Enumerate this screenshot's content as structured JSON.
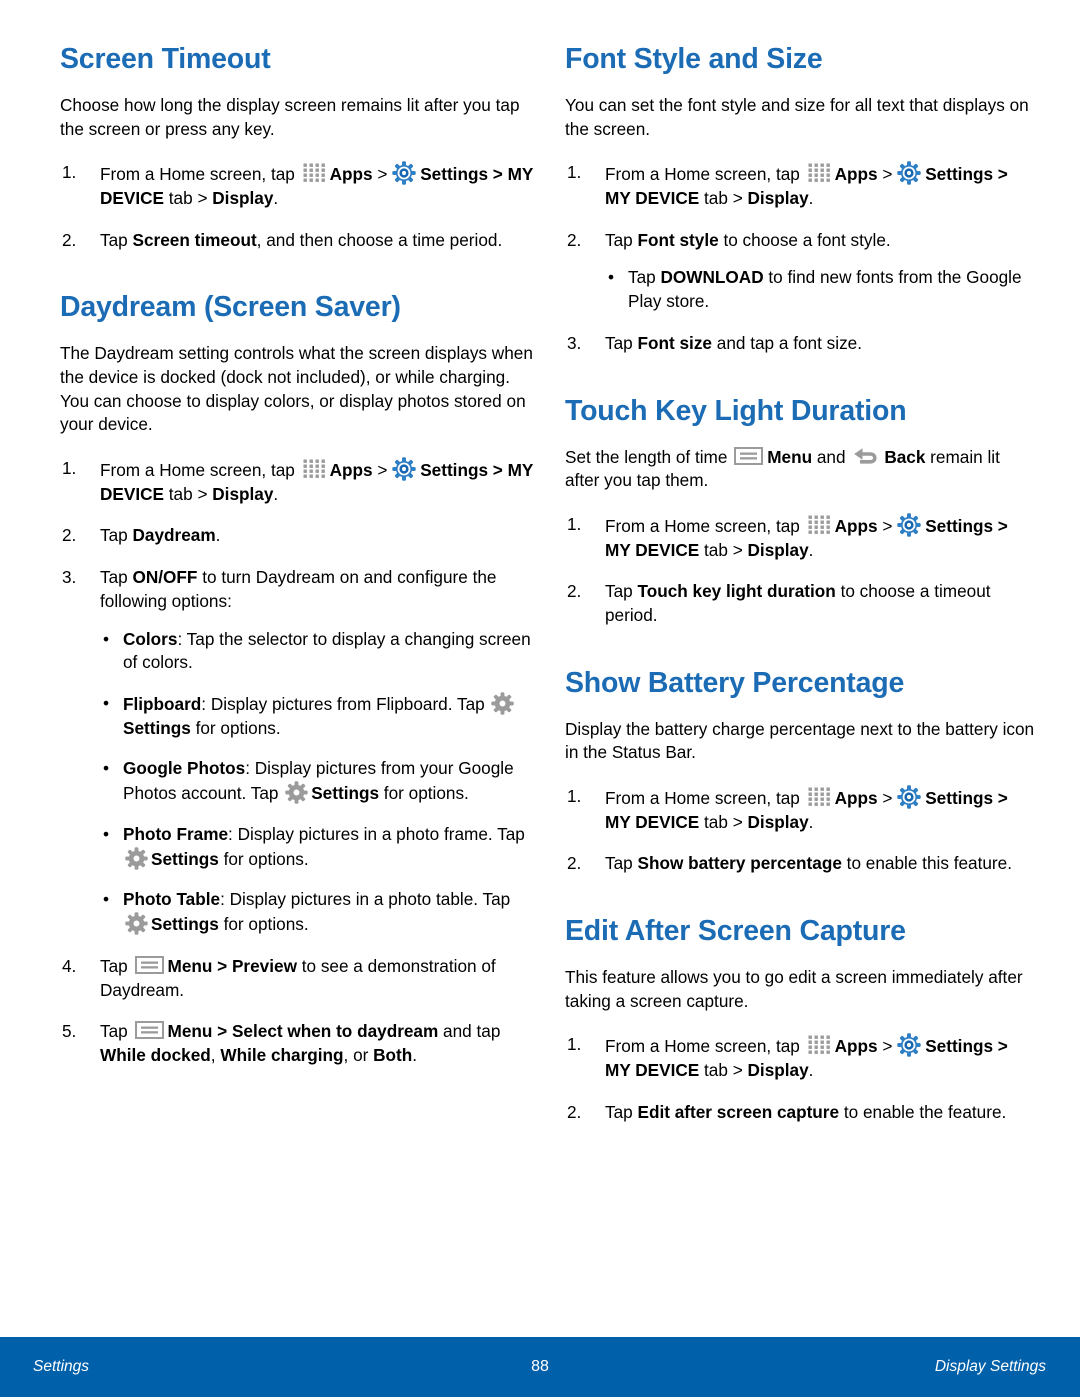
{
  "colors": {
    "heading_blue": "#1b6cb4",
    "footer_blue": "#0060a9",
    "settings_icon_blue": "#1b6cb4",
    "gray_icon": "#999999"
  },
  "left_column": {
    "sections": [
      {
        "heading": "Screen Timeout",
        "intro": "Choose how long the display screen remains lit after you tap the screen or press any key.",
        "steps": [
          {
            "num": "1.",
            "parts": [
              {
                "t": "text",
                "v": "From a Home screen, tap "
              },
              {
                "t": "icon",
                "v": "apps-grid-icon"
              },
              {
                "t": "bold",
                "v": "Apps"
              },
              {
                "t": "text",
                "v": " > "
              },
              {
                "t": "icon",
                "v": "settings-gear-blue-icon"
              },
              {
                "t": "bold",
                "v": "Settings > MY DEVICE"
              },
              {
                "t": "text",
                "v": " tab > "
              },
              {
                "t": "bold",
                "v": "Display"
              },
              {
                "t": "text",
                "v": "."
              }
            ]
          },
          {
            "num": "2.",
            "parts": [
              {
                "t": "text",
                "v": "Tap "
              },
              {
                "t": "bold",
                "v": "Screen timeout"
              },
              {
                "t": "text",
                "v": ", and then choose a time period."
              }
            ]
          }
        ]
      },
      {
        "heading": "Daydream (Screen Saver)",
        "intro": "The Daydream setting controls what the screen displays when the device is docked (dock not included), or while charging. You can choose to display colors, or display photos stored on your device.",
        "steps": [
          {
            "num": "1.",
            "parts": [
              {
                "t": "text",
                "v": "From a Home screen, tap "
              },
              {
                "t": "icon",
                "v": "apps-grid-icon"
              },
              {
                "t": "bold",
                "v": "Apps"
              },
              {
                "t": "text",
                "v": " > "
              },
              {
                "t": "icon",
                "v": "settings-gear-blue-icon"
              },
              {
                "t": "bold",
                "v": "Settings > MY DEVICE"
              },
              {
                "t": "text",
                "v": " tab > "
              },
              {
                "t": "bold",
                "v": "Display"
              },
              {
                "t": "text",
                "v": "."
              }
            ]
          },
          {
            "num": "2.",
            "parts": [
              {
                "t": "text",
                "v": "Tap "
              },
              {
                "t": "bold",
                "v": "Daydream"
              },
              {
                "t": "text",
                "v": "."
              }
            ]
          },
          {
            "num": "3.",
            "parts": [
              {
                "t": "text",
                "v": "Tap "
              },
              {
                "t": "bold",
                "v": "ON/OFF"
              },
              {
                "t": "text",
                "v": " to turn Daydream on and configure the following options:"
              }
            ],
            "bullets": [
              [
                {
                  "t": "bold",
                  "v": "Colors"
                },
                {
                  "t": "text",
                  "v": ": Tap the selector to display a changing screen of colors."
                }
              ],
              [
                {
                  "t": "bold",
                  "v": "Flipboard"
                },
                {
                  "t": "text",
                  "v": ": Display pictures from Flipboard. Tap "
                },
                {
                  "t": "icon",
                  "v": "settings-gear-gray-icon"
                },
                {
                  "t": "bold",
                  "v": "Settings"
                },
                {
                  "t": "text",
                  "v": " for options."
                }
              ],
              [
                {
                  "t": "bold",
                  "v": "Google Photos"
                },
                {
                  "t": "text",
                  "v": ": Display pictures from your Google Photos account. Tap "
                },
                {
                  "t": "icon",
                  "v": "settings-gear-gray-icon"
                },
                {
                  "t": "bold",
                  "v": "Settings"
                },
                {
                  "t": "text",
                  "v": " for options."
                }
              ],
              [
                {
                  "t": "bold",
                  "v": "Photo Frame"
                },
                {
                  "t": "text",
                  "v": ": Display pictures in a photo frame. Tap "
                },
                {
                  "t": "icon",
                  "v": "settings-gear-gray-icon"
                },
                {
                  "t": "bold",
                  "v": "Settings"
                },
                {
                  "t": "text",
                  "v": " for options."
                }
              ],
              [
                {
                  "t": "bold",
                  "v": "Photo Table"
                },
                {
                  "t": "text",
                  "v": ": Display pictures in a photo table. Tap "
                },
                {
                  "t": "icon",
                  "v": "settings-gear-gray-icon"
                },
                {
                  "t": "bold",
                  "v": "Settings"
                },
                {
                  "t": "text",
                  "v": " for options."
                }
              ]
            ]
          },
          {
            "num": "4.",
            "parts": [
              {
                "t": "text",
                "v": "Tap "
              },
              {
                "t": "icon",
                "v": "menu-icon"
              },
              {
                "t": "bold",
                "v": "Menu > Preview"
              },
              {
                "t": "text",
                "v": " to see a demonstration of Daydream."
              }
            ]
          },
          {
            "num": "5.",
            "parts": [
              {
                "t": "text",
                "v": "Tap "
              },
              {
                "t": "icon",
                "v": "menu-icon"
              },
              {
                "t": "bold",
                "v": "Menu > Select when to daydream"
              },
              {
                "t": "text",
                "v": " and tap "
              },
              {
                "t": "bold",
                "v": "While docked"
              },
              {
                "t": "text",
                "v": ", "
              },
              {
                "t": "bold",
                "v": "While charging"
              },
              {
                "t": "text",
                "v": ", or "
              },
              {
                "t": "bold",
                "v": "Both"
              },
              {
                "t": "text",
                "v": "."
              }
            ]
          }
        ]
      }
    ]
  },
  "right_column": {
    "sections": [
      {
        "heading": "Font Style and Size",
        "intro": "You can set the font style and size for all text that displays on the screen.",
        "steps": [
          {
            "num": "1.",
            "parts": [
              {
                "t": "text",
                "v": "From a Home screen, tap "
              },
              {
                "t": "icon",
                "v": "apps-grid-icon"
              },
              {
                "t": "bold",
                "v": "Apps"
              },
              {
                "t": "text",
                "v": " > "
              },
              {
                "t": "icon",
                "v": "settings-gear-blue-icon"
              },
              {
                "t": "bold",
                "v": "Settings > MY DEVICE"
              },
              {
                "t": "text",
                "v": " tab > "
              },
              {
                "t": "bold",
                "v": "Display"
              },
              {
                "t": "text",
                "v": "."
              }
            ]
          },
          {
            "num": "2.",
            "parts": [
              {
                "t": "text",
                "v": "Tap "
              },
              {
                "t": "bold",
                "v": "Font style"
              },
              {
                "t": "text",
                "v": " to choose a font style."
              }
            ],
            "bullets": [
              [
                {
                  "t": "text",
                  "v": "Tap "
                },
                {
                  "t": "bold",
                  "v": "DOWNLOAD"
                },
                {
                  "t": "text",
                  "v": " to find new fonts from the Google Play store."
                }
              ]
            ]
          },
          {
            "num": "3.",
            "parts": [
              {
                "t": "text",
                "v": "Tap "
              },
              {
                "t": "bold",
                "v": "Font size"
              },
              {
                "t": "text",
                "v": " and tap a font size."
              }
            ]
          }
        ]
      },
      {
        "heading": "Touch Key Light Duration",
        "intro_parts": [
          {
            "t": "text",
            "v": "Set the length of time "
          },
          {
            "t": "icon",
            "v": "menu-icon"
          },
          {
            "t": "bold",
            "v": "Menu"
          },
          {
            "t": "text",
            "v": " and "
          },
          {
            "t": "icon",
            "v": "back-arrow-icon"
          },
          {
            "t": "bold",
            "v": "Back"
          },
          {
            "t": "text",
            "v": " remain lit after you tap them."
          }
        ],
        "steps": [
          {
            "num": "1.",
            "parts": [
              {
                "t": "text",
                "v": "From a Home screen, tap "
              },
              {
                "t": "icon",
                "v": "apps-grid-icon"
              },
              {
                "t": "bold",
                "v": "Apps"
              },
              {
                "t": "text",
                "v": " > "
              },
              {
                "t": "icon",
                "v": "settings-gear-blue-icon"
              },
              {
                "t": "bold",
                "v": "Settings > MY DEVICE"
              },
              {
                "t": "text",
                "v": " tab > "
              },
              {
                "t": "bold",
                "v": "Display"
              },
              {
                "t": "text",
                "v": "."
              }
            ]
          },
          {
            "num": "2.",
            "parts": [
              {
                "t": "text",
                "v": "Tap "
              },
              {
                "t": "bold",
                "v": "Touch key light duration"
              },
              {
                "t": "text",
                "v": " to choose a timeout period."
              }
            ]
          }
        ]
      },
      {
        "heading": "Show Battery Percentage",
        "intro": "Display the battery charge percentage next to the battery icon in the Status Bar.",
        "steps": [
          {
            "num": "1.",
            "parts": [
              {
                "t": "text",
                "v": "From a Home screen, tap "
              },
              {
                "t": "icon",
                "v": "apps-grid-icon"
              },
              {
                "t": "bold",
                "v": "Apps"
              },
              {
                "t": "text",
                "v": " > "
              },
              {
                "t": "icon",
                "v": "settings-gear-blue-icon"
              },
              {
                "t": "bold",
                "v": "Settings > MY DEVICE"
              },
              {
                "t": "text",
                "v": " tab > "
              },
              {
                "t": "bold",
                "v": "Display"
              },
              {
                "t": "text",
                "v": "."
              }
            ]
          },
          {
            "num": "2.",
            "parts": [
              {
                "t": "text",
                "v": "Tap "
              },
              {
                "t": "bold",
                "v": "Show battery percentage"
              },
              {
                "t": "text",
                "v": " to enable this feature."
              }
            ]
          }
        ]
      },
      {
        "heading": "Edit After Screen Capture",
        "intro": "This feature allows you to go edit a screen immediately after taking a screen capture.",
        "steps": [
          {
            "num": "1.",
            "parts": [
              {
                "t": "text",
                "v": "From a Home screen, tap "
              },
              {
                "t": "icon",
                "v": "apps-grid-icon"
              },
              {
                "t": "bold",
                "v": "Apps"
              },
              {
                "t": "text",
                "v": " > "
              },
              {
                "t": "icon",
                "v": "settings-gear-blue-icon"
              },
              {
                "t": "bold",
                "v": "Settings > MY DEVICE"
              },
              {
                "t": "text",
                "v": " tab > "
              },
              {
                "t": "bold",
                "v": "Display"
              },
              {
                "t": "text",
                "v": "."
              }
            ]
          },
          {
            "num": "2.",
            "parts": [
              {
                "t": "text",
                "v": "Tap "
              },
              {
                "t": "bold",
                "v": "Edit after screen capture"
              },
              {
                "t": "text",
                "v": " to enable the feature."
              }
            ]
          }
        ]
      }
    ]
  },
  "footer": {
    "left": "Settings",
    "page_number": "88",
    "right": "Display Settings"
  }
}
